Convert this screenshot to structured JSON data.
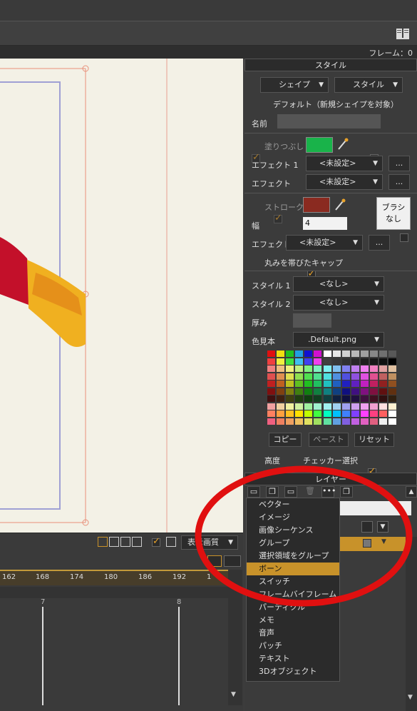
{
  "header": {
    "frame_label": "フレーム：0",
    "book_icon": "book-icon"
  },
  "style_panel": {
    "title": "スタイル",
    "shape_button": "シェイプ",
    "style_button": "スタイル",
    "default_text": "デフォルト（新規シェイプを対象）",
    "name_label": "名前",
    "fill_label": "塗りつぶし",
    "effect1_label": "エフェクト 1",
    "effect1_value": "<未設定>",
    "effect2_label": "エフェクト",
    "effect2_value": "<未設定>",
    "more": "...",
    "stroke_label": "ストローク",
    "brush_label": "ブラシ\nなし",
    "width_label": "幅",
    "width_value": "4",
    "effect3_label": "エフェクト",
    "effect3_value": "<未設定>",
    "round_cap_label": "丸みを帯びたキャップ",
    "style1_label": "スタイル 1",
    "style1_value": "<なし>",
    "style2_label": "スタイル 2",
    "style2_value": "<なし>",
    "thickness_label": "厚み",
    "swatch_label": "色見本",
    "swatch_value": ".Default.png",
    "copy_button": "コピー",
    "paste_button": "ペースト",
    "reset_button": "リセット",
    "advanced_label": "高度",
    "checker_label": "チェッカー選択",
    "fill_color": "#19b34a",
    "stroke_color": "#8a2a20"
  },
  "layer_panel": {
    "title": "レイヤー",
    "menu_items": [
      "ベクター",
      "イメージ",
      "画像シーケンス",
      "グループ",
      "選択領域をグループ",
      "ボーン",
      "スイッチ",
      "フレームバイフレーム",
      "パーティクル",
      "メモ",
      "音声",
      "パッチ",
      "テキスト",
      "3Dオブジェクト"
    ],
    "selected_item": "ボーン"
  },
  "canvas_toolbar": {
    "quality_label": "表示画質"
  },
  "timeline": {
    "ruler_ticks": [
      "162",
      "168",
      "174",
      "180",
      "186",
      "192",
      "1"
    ],
    "frame_markers": [
      "7",
      "8"
    ]
  }
}
